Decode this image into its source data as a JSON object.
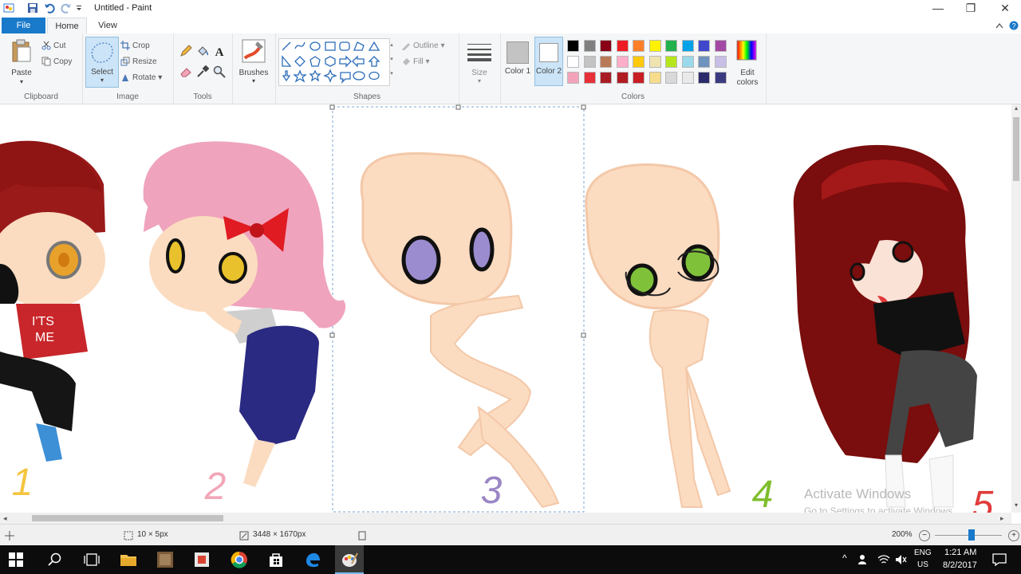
{
  "window": {
    "title": "Untitled - Paint"
  },
  "tabs": [
    {
      "label": "File"
    },
    {
      "label": "Home"
    },
    {
      "label": "View"
    }
  ],
  "clipboard": {
    "paste": "Paste",
    "cut": "Cut",
    "copy": "Copy",
    "group": "Clipboard"
  },
  "image": {
    "select": "Select",
    "crop": "Crop",
    "resize": "Resize",
    "rotate": "Rotate",
    "group": "Image"
  },
  "tools": {
    "group": "Tools"
  },
  "brushes": {
    "label": "Brushes"
  },
  "shapes": {
    "outline": "Outline",
    "fill": "Fill",
    "group": "Shapes"
  },
  "size": {
    "label": "Size"
  },
  "colors": {
    "color1_label": "Color 1",
    "color2_label": "Color 2",
    "edit": "Edit colors",
    "group": "Colors",
    "palette_row1": [
      "#000000",
      "#7f7f7f",
      "#880015",
      "#ed1c24",
      "#ff7f27",
      "#fff200",
      "#22b14c",
      "#00a2e8",
      "#3f48cc",
      "#a349a4"
    ],
    "palette_row2": [
      "#ffffff",
      "#c3c3c3",
      "#b97a57",
      "#ffaec9",
      "#ffc90e",
      "#efe4b0",
      "#b5e61d",
      "#99d9ea",
      "#7092be",
      "#c8bfe7"
    ],
    "palette_row3": [
      "#f3a3b9",
      "#e73038",
      "#a81d24",
      "#b01c22",
      "#c81e24",
      "#f6dc8c",
      "#d9d9d9",
      "#eaeaea",
      "#2b2b6b",
      "#3a3a80"
    ]
  },
  "canvas": {
    "labels": [
      {
        "text": "1",
        "color": "#f4c542"
      },
      {
        "text": "2",
        "color": "#f2a6b8"
      },
      {
        "text": "3",
        "color": "#9a86c5"
      },
      {
        "text": "4",
        "color": "#7fbd2c"
      },
      {
        "text": "5",
        "color": "#e03a3a"
      }
    ],
    "shirt_text_line1": "I'TS",
    "shirt_text_line2": "ME"
  },
  "watermark": {
    "line1": "Activate Windows",
    "line2": "Go to Settings to activate Windows."
  },
  "status": {
    "selection_size": "10 × 5px",
    "image_size": "3448 × 1670px",
    "zoom": "200%"
  },
  "taskbar": {
    "lang1": "ENG",
    "lang2": "US",
    "time": "1:21 AM",
    "date": "8/2/2017"
  }
}
